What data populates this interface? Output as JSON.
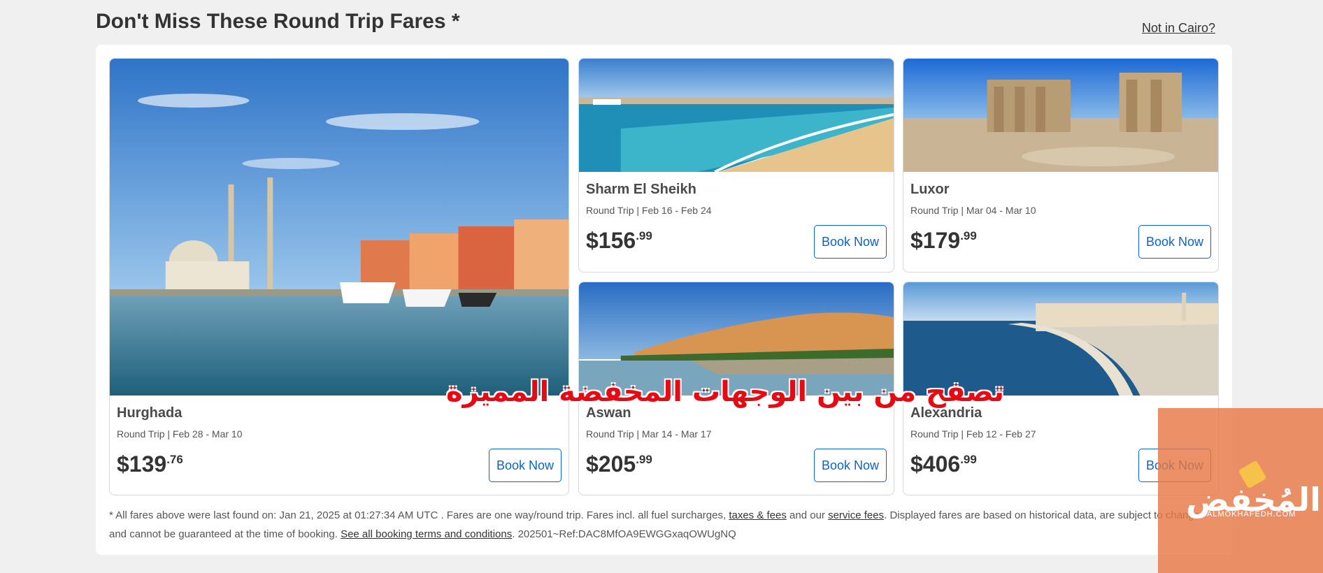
{
  "header": {
    "title": "Don't Miss These Round Trip Fares *",
    "location_link": "Not in Cairo?"
  },
  "cards": [
    {
      "destination": "Hurghada",
      "dates": "Round Trip | Feb 28 - Mar 10",
      "price_dollars": "$139",
      "price_cents": ".76",
      "button": "Book Now"
    },
    {
      "destination": "Sharm El Sheikh",
      "dates": "Round Trip | Feb 16 - Feb 24",
      "price_dollars": "$156",
      "price_cents": ".99",
      "button": "Book Now"
    },
    {
      "destination": "Luxor",
      "dates": "Round Trip | Mar 04 - Mar 10",
      "price_dollars": "$179",
      "price_cents": ".99",
      "button": "Book Now"
    },
    {
      "destination": "Aswan",
      "dates": "Round Trip | Mar 14 - Mar 17",
      "price_dollars": "$205",
      "price_cents": ".99",
      "button": "Book Now"
    },
    {
      "destination": "Alexandria",
      "dates": "Round Trip | Feb 12 - Feb 27",
      "price_dollars": "$406",
      "price_cents": ".99",
      "button": "Book Now"
    }
  ],
  "footnote": {
    "part1": "* All fares above were last found on: Jan 21, 2025 at 01:27:34 AM UTC . Fares are one way/round trip. Fares incl. all fuel surcharges, ",
    "taxes_link": "taxes & fees",
    "part2": " and our ",
    "service_link": "service fees",
    "part3": ". Displayed fares are based on historical data, are subject to change and cannot be guaranteed at the time of booking. ",
    "terms_link": "See all booking terms and conditions",
    "part4": ". 202501~Ref:DAC8MfOA9EWGGxaqOWUgNQ"
  },
  "overlay": {
    "caption": "تصفح من بين الوجهات المخفضة المميزة",
    "watermark_text": "المُخفض",
    "watermark_sub": "ALMOKHAFEDH.COM"
  },
  "colors": {
    "accent": "#0a64c8",
    "caption": "#e60a14",
    "watermark": "#e87846"
  }
}
